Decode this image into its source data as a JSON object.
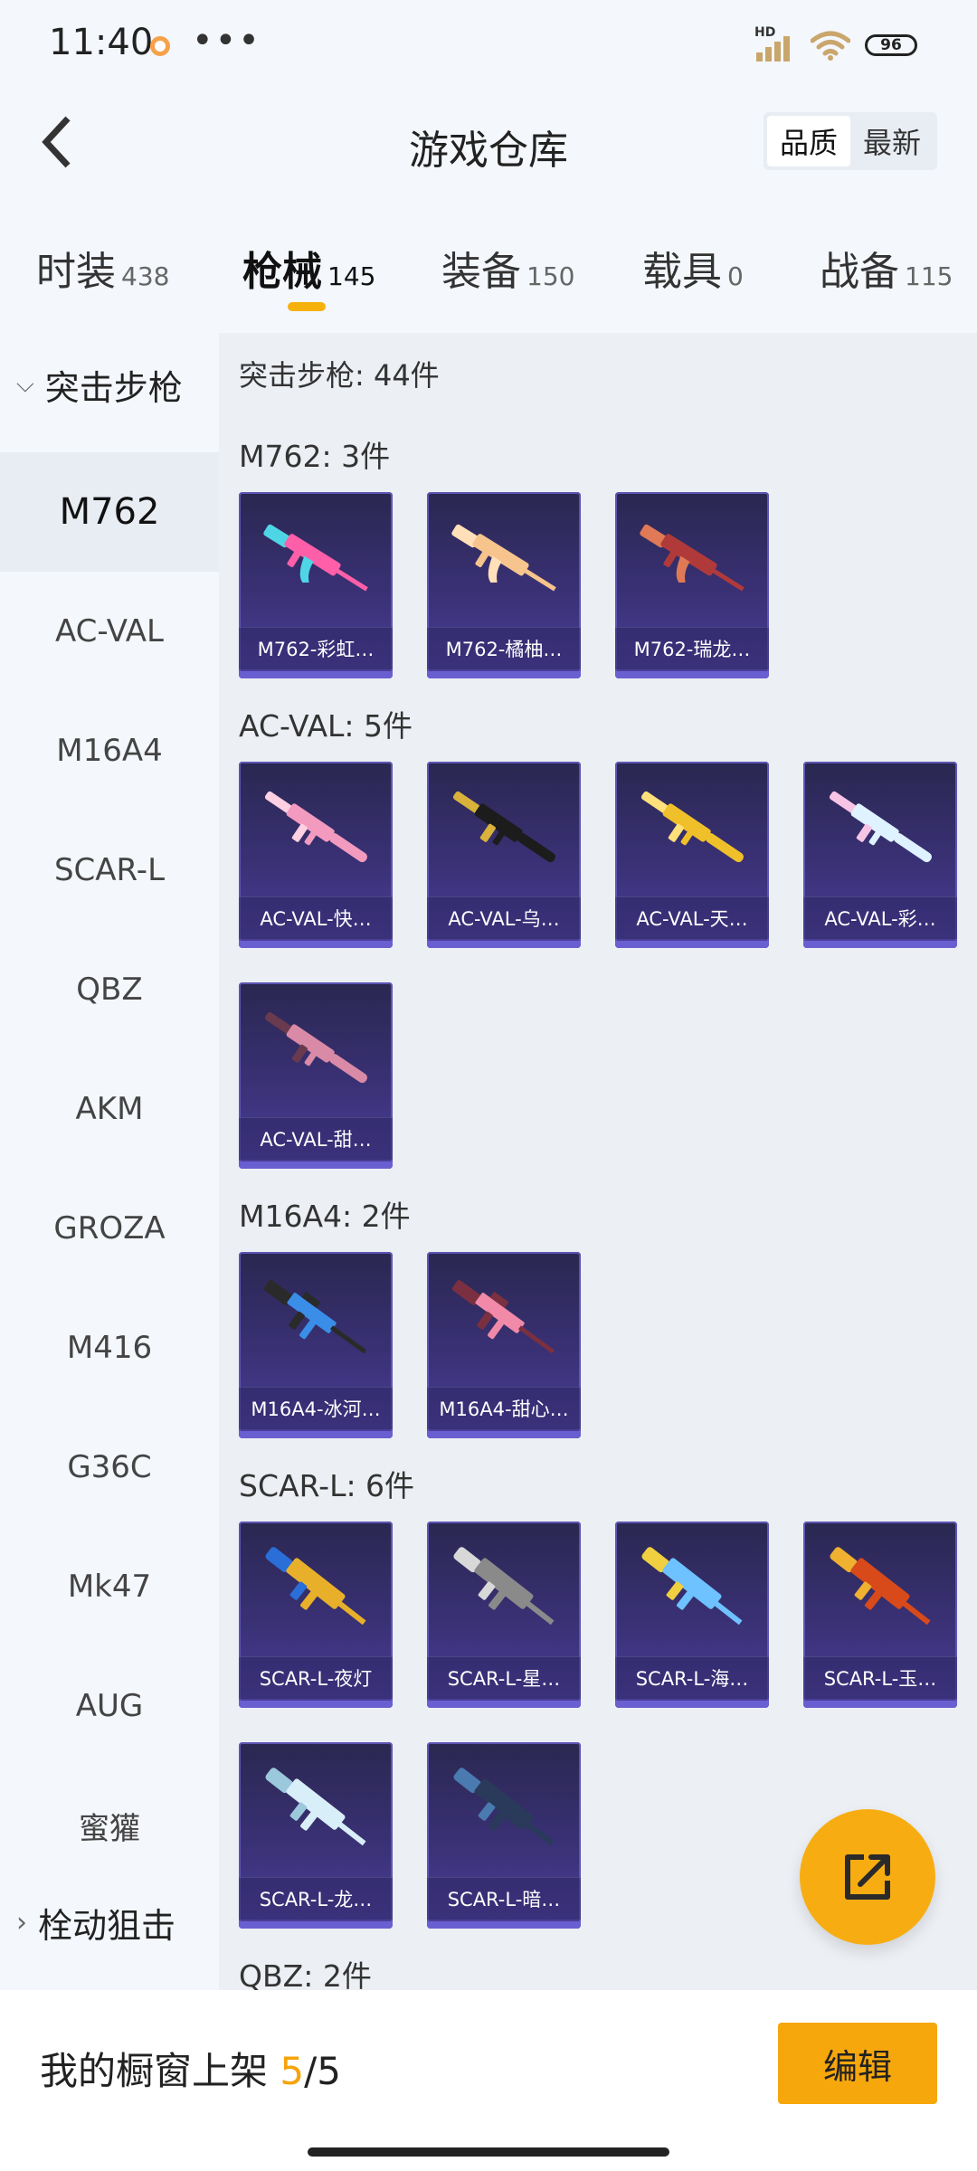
{
  "status": {
    "time": "11:40",
    "dots": "•••",
    "hd": "HD",
    "battery": "96"
  },
  "header": {
    "title": "游戏仓库",
    "sort_options": [
      "品质",
      "最新"
    ],
    "active_sort": "品质"
  },
  "tabs": [
    {
      "label": "时装",
      "count": "438"
    },
    {
      "label": "枪械",
      "count": "145"
    },
    {
      "label": "装备",
      "count": "150"
    },
    {
      "label": "载具",
      "count": "0"
    },
    {
      "label": "战备",
      "count": "115"
    }
  ],
  "sidebar": {
    "category": "突击步枪",
    "items": [
      "M762",
      "AC-VAL",
      "M16A4",
      "SCAR-L",
      "QBZ",
      "AKM",
      "GROZA",
      "M416",
      "G36C",
      "Mk47",
      "AUG",
      "蜜獾"
    ],
    "active_item": "M762",
    "next_category": "栓动狙击"
  },
  "content": {
    "category_total": "突击步枪: 44件",
    "groups": [
      {
        "label": "M762: 3件",
        "items": [
          "M762-彩虹…",
          "M762-橘柚…",
          "M762-瑞龙…"
        ]
      },
      {
        "label": "AC-VAL: 5件",
        "items": [
          "AC-VAL-快…",
          "AC-VAL-乌…",
          "AC-VAL-天…",
          "AC-VAL-彩…",
          "AC-VAL-甜…"
        ]
      },
      {
        "label": "M16A4: 2件",
        "items": [
          "M16A4-冰河…",
          "M16A4-甜心…"
        ]
      },
      {
        "label": "SCAR-L: 6件",
        "items": [
          "SCAR-L-夜灯",
          "SCAR-L-星…",
          "SCAR-L-海…",
          "SCAR-L-玉…",
          "SCAR-L-龙…",
          "SCAR-L-暗…"
        ]
      },
      {
        "label": "QBZ: 2件",
        "items": []
      }
    ]
  },
  "bottom": {
    "showcase_label": "我的橱窗上架 ",
    "current": "5",
    "separator": "/",
    "total": "5",
    "edit_label": "编辑"
  },
  "colors": {
    "accent": "#f6a70c",
    "card_bg": "#3a3176",
    "card_border": "#5d55b4"
  },
  "icons": {
    "back": "chevron-left-icon",
    "share": "share-external-icon",
    "collapse": "chevron-down-icon",
    "expand": "chevron-right-icon"
  }
}
